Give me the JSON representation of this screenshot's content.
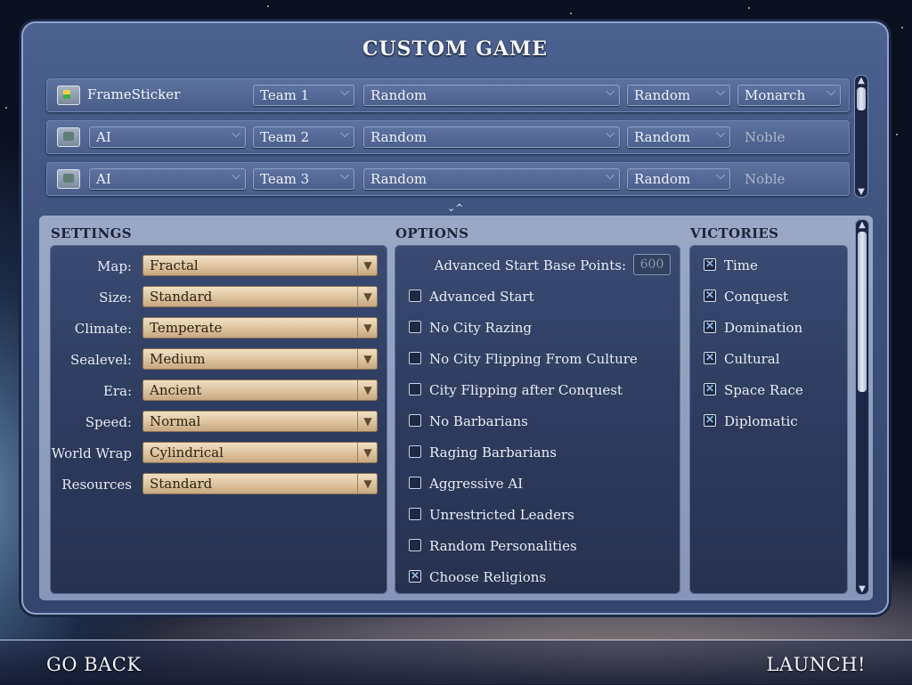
{
  "title": "CUSTOM GAME",
  "players": [
    {
      "type": "human",
      "name": "FrameSticker",
      "team": "Team 1",
      "civ": "Random",
      "leader": "Random",
      "difficulty": "Monarch",
      "difficulty_editable": true
    },
    {
      "type": "ai",
      "name": "AI",
      "team": "Team 2",
      "civ": "Random",
      "leader": "Random",
      "difficulty": "Noble",
      "difficulty_editable": false
    },
    {
      "type": "ai",
      "name": "AI",
      "team": "Team 3",
      "civ": "Random",
      "leader": "Random",
      "difficulty": "Noble",
      "difficulty_editable": false
    }
  ],
  "collapse_glyph": "⌄^",
  "settings": {
    "heading": "SETTINGS",
    "rows": [
      {
        "label": "Map:",
        "value": "Fractal"
      },
      {
        "label": "Size:",
        "value": "Standard"
      },
      {
        "label": "Climate:",
        "value": "Temperate"
      },
      {
        "label": "Sealevel:",
        "value": "Medium"
      },
      {
        "label": "Era:",
        "value": "Ancient"
      },
      {
        "label": "Speed:",
        "value": "Normal"
      },
      {
        "label": "World Wrap",
        "value": "Cylindrical"
      },
      {
        "label": "Resources",
        "value": "Standard"
      }
    ]
  },
  "options": {
    "heading": "OPTIONS",
    "base_points_label": "Advanced Start Base Points:",
    "base_points_value": "600",
    "items": [
      {
        "label": "Advanced Start",
        "checked": false
      },
      {
        "label": "No City Razing",
        "checked": false
      },
      {
        "label": "No City Flipping From Culture",
        "checked": false
      },
      {
        "label": "City Flipping after Conquest",
        "checked": false
      },
      {
        "label": "No Barbarians",
        "checked": false
      },
      {
        "label": "Raging Barbarians",
        "checked": false
      },
      {
        "label": "Aggressive AI",
        "checked": false
      },
      {
        "label": "Unrestricted Leaders",
        "checked": false
      },
      {
        "label": "Random Personalities",
        "checked": false
      },
      {
        "label": "Choose Religions",
        "checked": true
      }
    ]
  },
  "victories": {
    "heading": "VICTORIES",
    "items": [
      {
        "label": "Time",
        "checked": true
      },
      {
        "label": "Conquest",
        "checked": true
      },
      {
        "label": "Domination",
        "checked": true
      },
      {
        "label": "Cultural",
        "checked": true
      },
      {
        "label": "Space Race",
        "checked": true
      },
      {
        "label": "Diplomatic",
        "checked": true
      }
    ]
  },
  "footer": {
    "back": "GO BACK",
    "launch": "LAUNCH!"
  }
}
